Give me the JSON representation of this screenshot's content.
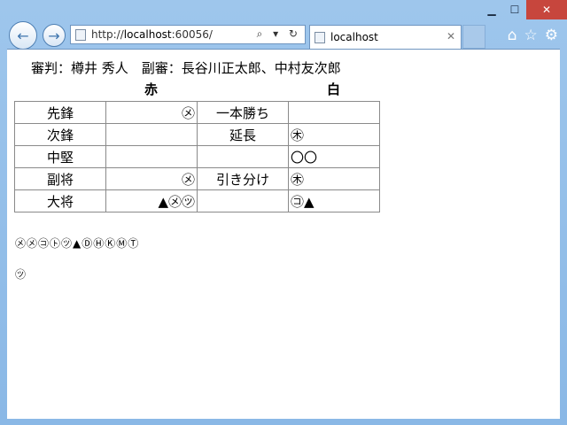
{
  "browser": {
    "url_prefix": "http://",
    "url_host": "localhost",
    "url_suffix": ":60056/",
    "tab_title": "localhost",
    "address_tools": "⌕ ▾ ↻"
  },
  "page": {
    "referees": "審判：樽井 秀人　副審：長谷川正太郎、中村友次郎",
    "red_label": "赤",
    "white_label": "白",
    "rows": [
      {
        "position": "先鋒",
        "red": "㋱",
        "result": "一本勝ち",
        "white": ""
      },
      {
        "position": "次鋒",
        "red": "",
        "result": "延長",
        "white": "㊍"
      },
      {
        "position": "中堅",
        "red": "",
        "result": "",
        "white": "〇〇"
      },
      {
        "position": "副将",
        "red": "㋱",
        "result": "引き分け",
        "white": "㊍"
      },
      {
        "position": "大将",
        "red": "▲㋱㋡",
        "result": "",
        "white": "㋙▲"
      }
    ],
    "legend": "㋱㋱㋙㋣㋡▲ⒹⒽⓀⓂⓉ",
    "legend2": "㋡"
  }
}
